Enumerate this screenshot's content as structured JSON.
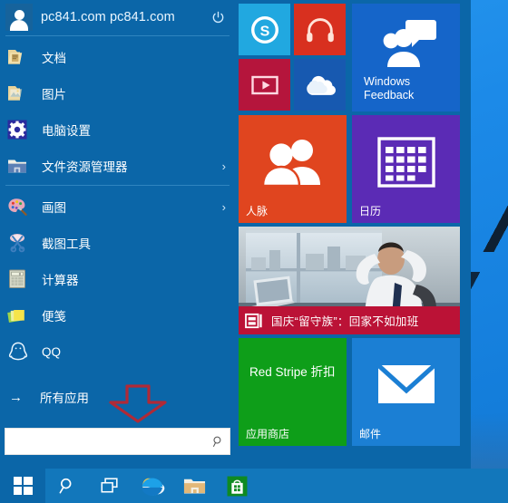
{
  "desktop": {
    "name": "windows-desktop-wallpaper"
  },
  "start_menu": {
    "user": {
      "display_name": "pc841.com pc841.com",
      "avatar_name": "user-avatar",
      "power_label": "power"
    },
    "items": [
      {
        "label": "文档",
        "icon": "documents-folder-icon",
        "chevron": ""
      },
      {
        "label": "图片",
        "icon": "pictures-folder-icon",
        "chevron": ""
      },
      {
        "label": "电脑设置",
        "icon": "pc-settings-gear-icon",
        "chevron": ""
      },
      {
        "label": "文件资源管理器",
        "icon": "file-explorer-icon",
        "chevron": "›"
      },
      {
        "label": "画图",
        "icon": "paint-palette-icon",
        "chevron": "›"
      },
      {
        "label": "截图工具",
        "icon": "snipping-tool-icon",
        "chevron": ""
      },
      {
        "label": "计算器",
        "icon": "calculator-icon",
        "chevron": ""
      },
      {
        "label": "便笺",
        "icon": "sticky-notes-icon",
        "chevron": ""
      },
      {
        "label": "QQ",
        "icon": "qq-penguin-icon",
        "chevron": ""
      }
    ],
    "all_apps": {
      "label": "所有应用",
      "arrow": "→"
    },
    "search": {
      "value": "",
      "placeholder": "",
      "icon": "search-icon"
    },
    "annotation": {
      "name": "red-down-arrow",
      "color": "#b02a37"
    }
  },
  "tiles": [
    {
      "name": "skype",
      "label": "",
      "color": "#21a8e0",
      "icon": "skype-icon"
    },
    {
      "name": "music",
      "label": "",
      "color": "#d8301f",
      "icon": "headphones-icon"
    },
    {
      "name": "windows-feedback",
      "label": "Windows\nFeedback",
      "color": "#1565c9",
      "icon": "feedback-people-icon",
      "label_line1": "Windows",
      "label_line2": "Feedback"
    },
    {
      "name": "video",
      "label": "",
      "color": "#b5153c",
      "icon": "video-play-icon"
    },
    {
      "name": "onedrive",
      "label": "",
      "color": "#1759b0",
      "icon": "onedrive-cloud-icon"
    },
    {
      "name": "people",
      "label": "人脉",
      "color": "#e0451f",
      "icon": "people-icon"
    },
    {
      "name": "calendar",
      "label": "日历",
      "color": "#5b2bb5",
      "icon": "calendar-icon"
    },
    {
      "name": "news",
      "label": "",
      "color": "#bb1236",
      "icon": "news-icon",
      "headline": "国庆“留守族”：回家不如加班"
    },
    {
      "name": "store",
      "label": "应用商店",
      "color": "#0e9e19",
      "icon": "store-icon",
      "promo": "Red Stripe 折扣"
    },
    {
      "name": "mail",
      "label": "邮件",
      "color": "#1b7fd4",
      "icon": "mail-envelope-icon"
    }
  ],
  "taskbar": {
    "buttons": [
      {
        "name": "start-button",
        "icon": "windows-logo-icon"
      },
      {
        "name": "search-button",
        "icon": "search-icon"
      },
      {
        "name": "task-view-button",
        "icon": "task-view-icon"
      },
      {
        "name": "internet-explorer-button",
        "icon": "internet-explorer-icon"
      },
      {
        "name": "file-explorer-button",
        "icon": "file-explorer-icon"
      },
      {
        "name": "store-button",
        "icon": "store-bag-icon"
      }
    ]
  }
}
